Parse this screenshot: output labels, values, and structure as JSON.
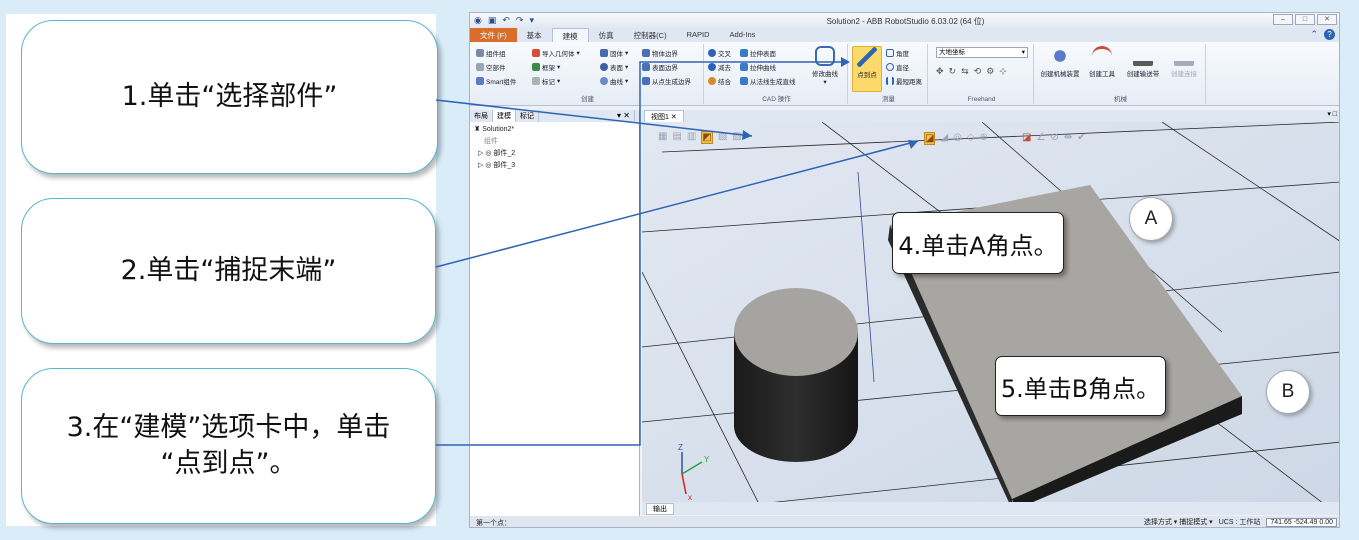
{
  "callouts": {
    "c1": "1.单击“选择部件”",
    "c2": "2.单击“捕捉末端”",
    "c3_line1": "3.在“建模”选项卡中，单击",
    "c3_line2": "“点到点”。",
    "c4": "4.单击A角点。",
    "c5": "5.单击B角点。",
    "point_a": "A",
    "point_b": "B"
  },
  "window": {
    "title": "Solution2 - ABB RobotStudio 6.03.02 (64 位)",
    "minimize": "–",
    "maximize": "□",
    "close": "✕"
  },
  "tabs": [
    "文件 (F)",
    "基本",
    "建模",
    "仿真",
    "控制器(C)",
    "RAPID",
    "Add-Ins"
  ],
  "ribbon": {
    "create": {
      "label": "创建",
      "items": [
        "组件组",
        "空部件",
        "Smart组件",
        "导入几何体",
        "框架",
        "标记",
        "固体",
        "表面",
        "曲线",
        "物体边界",
        "表面边界",
        "从点生成边界"
      ]
    },
    "cad": {
      "label": "CAD 操作",
      "items": [
        "交叉",
        "减去",
        "结合",
        "拉伸表面",
        "拉伸曲线",
        "从法线生成直线",
        "修改曲线"
      ]
    },
    "measure": {
      "label": "测量",
      "items": [
        "点到点",
        "角度",
        "直径",
        "最短距离"
      ]
    },
    "freehand": {
      "label": "Freehand",
      "combo": "大地坐标"
    },
    "machine": {
      "label": "机械",
      "items": [
        "创建机械装置",
        "创建工具",
        "创建输送带",
        "创建连接"
      ]
    }
  },
  "pane": {
    "tabs": [
      "布局",
      "建模",
      "标记"
    ],
    "tree": [
      "Solution2*",
      "组件",
      "部件_2",
      "部件_3"
    ]
  },
  "view": {
    "tab": "视图1 ✕"
  },
  "output": {
    "tab": "输出"
  },
  "status": {
    "left": "第一个点：",
    "mode": "选择方式 ▾ 捕捉模式 ▾",
    "ucs": "UCS : 工作站",
    "coords": "741.65 -524.49 0.00"
  },
  "axes": {
    "x": "x",
    "y": "Y",
    "z": "Z"
  },
  "colors": {
    "accent": "#2e64b4",
    "callout_border": "#5ab6cc",
    "file_tab": "#d86e2a",
    "active_button": "#fbd96a"
  }
}
